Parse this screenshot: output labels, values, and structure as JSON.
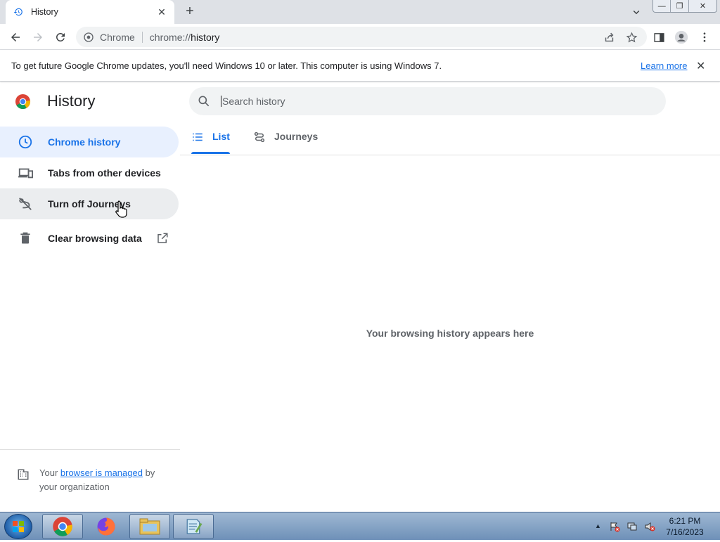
{
  "browser": {
    "tab_title": "History",
    "tab_close": "✕",
    "new_tab": "+",
    "omnibox": {
      "scheme_label": "Chrome",
      "url_prefix": "chrome://",
      "url_host": "history"
    }
  },
  "window_controls": {
    "minimize": "—",
    "restore": "❐",
    "close": "✕"
  },
  "infobar": {
    "message": "To get future Google Chrome updates, you'll need Windows 10 or later. This computer is using Windows 7.",
    "link": "Learn more",
    "close": "✕"
  },
  "sidebar": {
    "title": "History",
    "items": [
      {
        "label": "Chrome history",
        "icon": "clock-icon",
        "state": "active"
      },
      {
        "label": "Tabs from other devices",
        "icon": "devices-icon"
      },
      {
        "label": "Turn off Journeys",
        "icon": "journeys-off-icon",
        "state": "hover"
      },
      {
        "label": "Clear browsing data",
        "icon": "trash-icon",
        "trailing_icon": "open-in-new-icon"
      }
    ],
    "managed": {
      "prefix": "Your ",
      "link": "browser is managed",
      "suffix": " by your organization"
    }
  },
  "main": {
    "search_placeholder": "Search history",
    "tabs": [
      {
        "label": "List",
        "icon": "list-icon",
        "selected": true
      },
      {
        "label": "Journeys",
        "icon": "journeys-icon",
        "selected": false
      }
    ],
    "empty_message": "Your browsing history appears here"
  },
  "taskbar": {
    "apps": [
      "chrome-icon",
      "firefox-icon",
      "explorer-folder-icon",
      "notepad-icon"
    ],
    "clock_time": "6:21 PM",
    "clock_date": "7/16/2023"
  },
  "colors": {
    "accent": "#1a73e8",
    "active_bg": "#e8f0fe",
    "tabstrip": "#dee1e6",
    "omnibox": "#f1f3f4"
  }
}
